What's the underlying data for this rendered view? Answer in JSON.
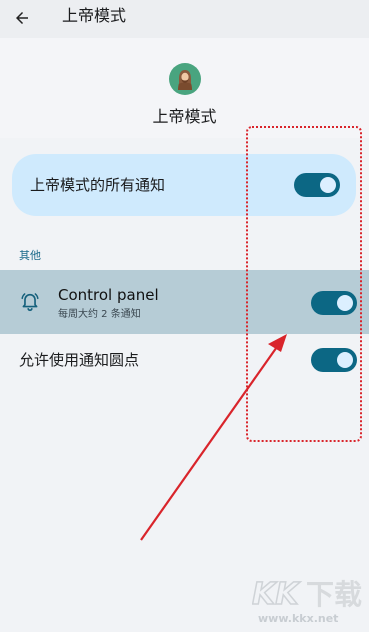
{
  "topbar": {
    "title": "上帝模式",
    "back_icon": "arrow-back-icon"
  },
  "app": {
    "name": "上帝模式",
    "icon": "god-avatar-icon"
  },
  "all_notifications": {
    "label": "上帝模式的所有通知",
    "enabled": true
  },
  "section": {
    "label": "其他"
  },
  "channel": {
    "title": "Control panel",
    "subtitle": "每周大约 2 条通知",
    "icon": "bell-icon",
    "enabled": true
  },
  "dots": {
    "label": "允许使用通知圆点",
    "enabled": true
  },
  "colors": {
    "accent": "#0c6784",
    "card": "#cfeafd",
    "highlight_row": "#b6ccd6",
    "annotation": "#d9242b"
  },
  "watermark": {
    "logo_text": "KK下载",
    "url": "www.kkx.net"
  }
}
